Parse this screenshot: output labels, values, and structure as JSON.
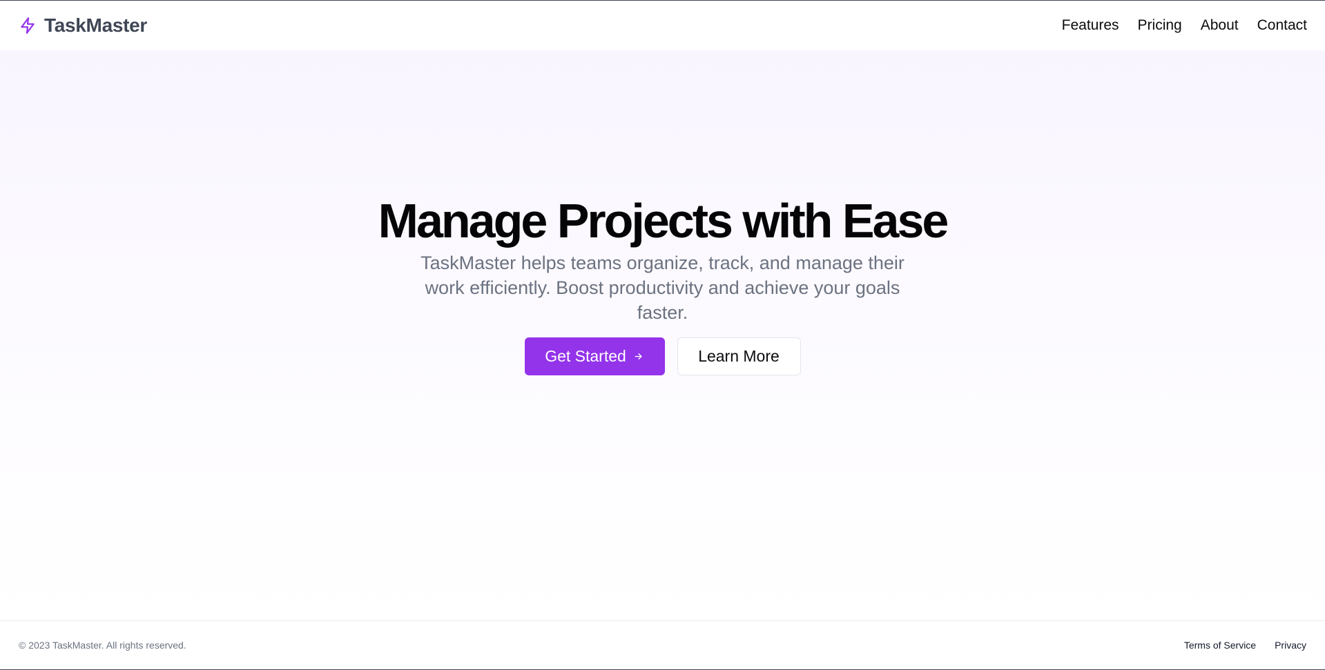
{
  "header": {
    "brand_name": "TaskMaster",
    "brand_icon": "lightning-bolt-icon",
    "nav": [
      {
        "label": "Features"
      },
      {
        "label": "Pricing"
      },
      {
        "label": "About"
      },
      {
        "label": "Contact"
      }
    ]
  },
  "hero": {
    "title": "Manage Projects with Ease",
    "subtitle": "TaskMaster helps teams organize, track, and manage their work efficiently. Boost productivity and achieve your goals faster.",
    "primary_button": "Get Started",
    "primary_button_icon": "arrow-right-icon",
    "secondary_button": "Learn More"
  },
  "footer": {
    "copyright": "© 2023 TaskMaster. All rights reserved.",
    "links": [
      {
        "label": "Terms of Service"
      },
      {
        "label": "Privacy"
      }
    ]
  },
  "colors": {
    "accent": "#9333ea",
    "brand_text": "#3f4655",
    "muted_text": "#6b7280",
    "hero_bg_top": "#f9f5ff"
  }
}
